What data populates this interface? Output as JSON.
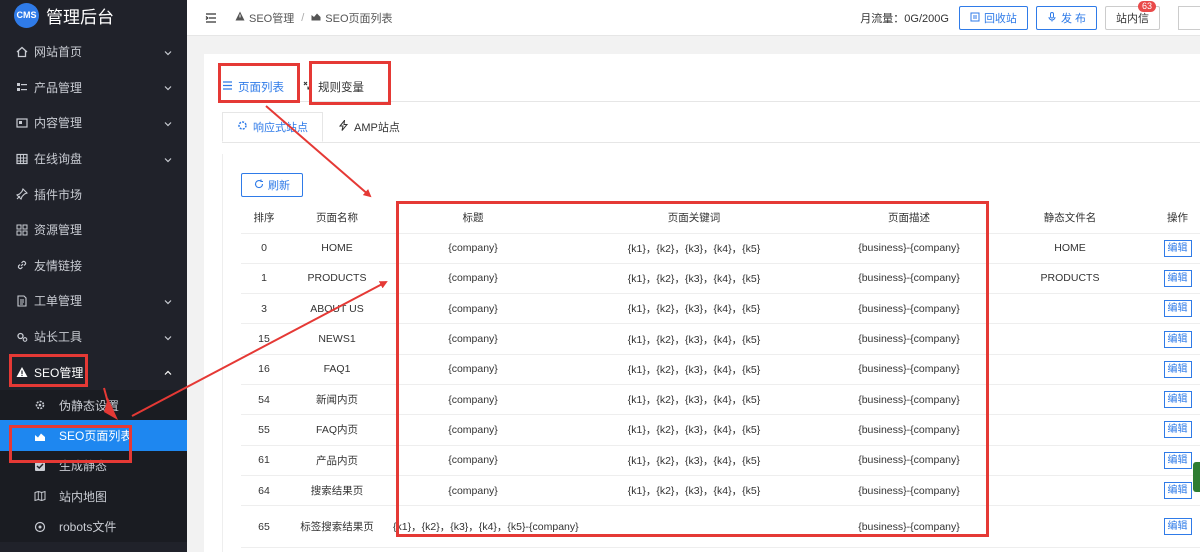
{
  "brand": {
    "logo_text": "CMS",
    "title": "管理后台"
  },
  "sidebar": {
    "items": [
      {
        "label": "网站首页",
        "icon": "home-icon"
      },
      {
        "label": "产品管理",
        "icon": "list-icon"
      },
      {
        "label": "内容管理",
        "icon": "article-icon"
      },
      {
        "label": "在线询盘",
        "icon": "grid-icon"
      },
      {
        "label": "插件市场",
        "icon": "pin-icon"
      },
      {
        "label": "资源管理",
        "icon": "apps-icon"
      },
      {
        "label": "友情链接",
        "icon": "link-icon"
      },
      {
        "label": "工单管理",
        "icon": "document-icon"
      },
      {
        "label": "站长工具",
        "icon": "gear-icon"
      },
      {
        "label": "SEO管理",
        "icon": "warning-icon"
      }
    ],
    "seo_sub": [
      {
        "label": "伪静态设置",
        "icon": "settings-icon"
      },
      {
        "label": "SEO页面列表",
        "icon": "area-chart-icon"
      },
      {
        "label": "生成静态",
        "icon": "checkbox-icon"
      },
      {
        "label": "站内地图",
        "icon": "map-icon"
      },
      {
        "label": "robots文件",
        "icon": "robot-icon"
      }
    ]
  },
  "topbar": {
    "breadcrumb": [
      "SEO管理",
      "SEO页面列表"
    ],
    "flow": "月流量：0G/200G",
    "recycle": "回收站",
    "publish": "发 布",
    "messages": "站内信",
    "messages_count": "63"
  },
  "tabs": {
    "page_list": "页面列表",
    "rule_vars": "规则变量"
  },
  "subtabs": {
    "responsive": "响应式站点",
    "amp": "AMP站点"
  },
  "refresh_label": "刷新",
  "table": {
    "headers": [
      "排序",
      "页面名称",
      "标题",
      "页面关键词",
      "页面描述",
      "静态文件名",
      "操作"
    ],
    "edit_label": "编辑",
    "rows": [
      {
        "order": "0",
        "name": "HOME",
        "title": "{company}",
        "keywords": "{k1}，{k2}，{k3}，{k4}，{k5}",
        "description": "{business}-{company}",
        "file": "HOME"
      },
      {
        "order": "1",
        "name": "PRODUCTS",
        "title": "{company}",
        "keywords": "{k1}，{k2}，{k3}，{k4}，{k5}",
        "description": "{business}-{company}",
        "file": "PRODUCTS"
      },
      {
        "order": "3",
        "name": "ABOUT US",
        "title": "{company}",
        "keywords": "{k1}，{k2}，{k3}，{k4}，{k5}",
        "description": "{business}-{company}",
        "file": ""
      },
      {
        "order": "15",
        "name": "NEWS1",
        "title": "{company}",
        "keywords": "{k1}，{k2}，{k3}，{k4}，{k5}",
        "description": "{business}-{company}",
        "file": ""
      },
      {
        "order": "16",
        "name": "FAQ1",
        "title": "{company}",
        "keywords": "{k1}，{k2}，{k3}，{k4}，{k5}",
        "description": "{business}-{company}",
        "file": ""
      },
      {
        "order": "54",
        "name": "新闻内页",
        "title": "{company}",
        "keywords": "{k1}，{k2}，{k3}，{k4}，{k5}",
        "description": "{business}-{company}",
        "file": ""
      },
      {
        "order": "55",
        "name": "FAQ内页",
        "title": "{company}",
        "keywords": "{k1}，{k2}，{k3}，{k4}，{k5}",
        "description": "{business}-{company}",
        "file": ""
      },
      {
        "order": "61",
        "name": "产品内页",
        "title": "{company}",
        "keywords": "{k1}，{k2}，{k3}，{k4}，{k5}",
        "description": "{business}-{company}",
        "file": ""
      },
      {
        "order": "64",
        "name": "搜索结果页",
        "title": "{company}",
        "keywords": "{k1}，{k2}，{k3}，{k4}，{k5}",
        "description": "{business}-{company}",
        "file": ""
      },
      {
        "order": "65",
        "name": "标签搜索结果页",
        "title": "{k1}，{k2}，{k3}，{k4}，{k5}-{company}",
        "keywords": "",
        "description": "{business}-{company}",
        "file": ""
      }
    ]
  },
  "colors": {
    "sidebar_bg": "#20222a",
    "accent": "#1e87f0",
    "annotation_red": "#e53935"
  }
}
